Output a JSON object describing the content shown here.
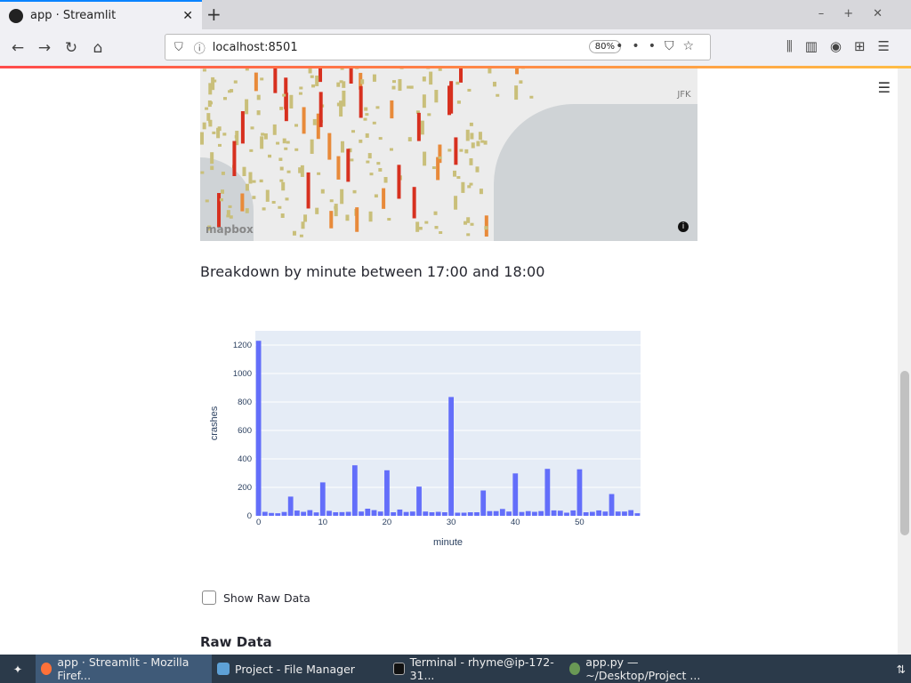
{
  "browser": {
    "tab_title": "app · Streamlit",
    "url": "localhost:8501",
    "zoom": "80%"
  },
  "map": {
    "attribution": "mapbox",
    "label": "JFK"
  },
  "section_title": "Breakdown by minute between 17:00 and 18:00",
  "checkbox": {
    "label": "Show Raw Data",
    "checked": false
  },
  "raw_heading": "Raw Data",
  "taskbar": {
    "items": [
      "app · Streamlit - Mozilla Firef...",
      "Project - File Manager",
      "Terminal - rhyme@ip-172-31...",
      "app.py — ~/Desktop/Project ..."
    ]
  },
  "chart_data": {
    "type": "bar",
    "title": "",
    "xlabel": "minute",
    "ylabel": "crashes",
    "ylim": [
      0,
      1300
    ],
    "xlim": [
      -0.5,
      59.5
    ],
    "xticks": [
      0,
      10,
      20,
      30,
      40,
      50
    ],
    "yticks": [
      0,
      200,
      400,
      600,
      800,
      1000,
      1200
    ],
    "color": "#636efa",
    "grid": true,
    "x": [
      0,
      1,
      2,
      3,
      4,
      5,
      6,
      7,
      8,
      9,
      10,
      11,
      12,
      13,
      14,
      15,
      16,
      17,
      18,
      19,
      20,
      21,
      22,
      23,
      24,
      25,
      26,
      27,
      28,
      29,
      30,
      31,
      32,
      33,
      34,
      35,
      36,
      37,
      38,
      39,
      40,
      41,
      42,
      43,
      44,
      45,
      46,
      47,
      48,
      49,
      50,
      51,
      52,
      53,
      54,
      55,
      56,
      57,
      58,
      59
    ],
    "values": [
      1230,
      28,
      20,
      18,
      27,
      135,
      37,
      28,
      40,
      24,
      235,
      35,
      25,
      26,
      28,
      355,
      30,
      50,
      40,
      30,
      320,
      25,
      44,
      27,
      30,
      205,
      30,
      25,
      28,
      25,
      835,
      22,
      22,
      25,
      25,
      178,
      33,
      33,
      48,
      30,
      298,
      27,
      33,
      28,
      33,
      330,
      38,
      36,
      22,
      38,
      327,
      25,
      28,
      38,
      30,
      153,
      30,
      30,
      40,
      18
    ]
  }
}
